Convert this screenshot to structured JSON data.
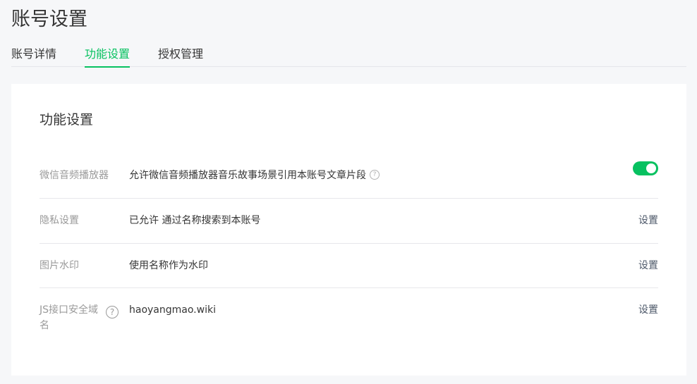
{
  "header": {
    "title": "账号设置"
  },
  "tabs": [
    {
      "label": "账号详情",
      "active": false
    },
    {
      "label": "功能设置",
      "active": true
    },
    {
      "label": "授权管理",
      "active": false
    }
  ],
  "card": {
    "title": "功能设置",
    "rows": [
      {
        "label": "微信音频播放器",
        "value": "允许微信音频播放器音乐故事场景引用本账号文章片段",
        "help_icon": "question-circle-icon",
        "control": "toggle",
        "toggle_on": true
      },
      {
        "label": "隐私设置",
        "value": "已允许 通过名称搜索到本账号",
        "action": "设置"
      },
      {
        "label": "图片水印",
        "value": "使用名称作为水印",
        "action": "设置"
      },
      {
        "label_line1": "JS接口安全域",
        "label_line2": "名",
        "value": "haoyangmao.wiki",
        "help_icon": "question-circle-icon",
        "action": "设置"
      }
    ]
  },
  "icons": {
    "help_glyph": "?"
  },
  "colors": {
    "accent": "#07c160",
    "background": "#f6f7f9",
    "card": "#ffffff",
    "label": "#9a9a9a",
    "text": "#353535"
  }
}
